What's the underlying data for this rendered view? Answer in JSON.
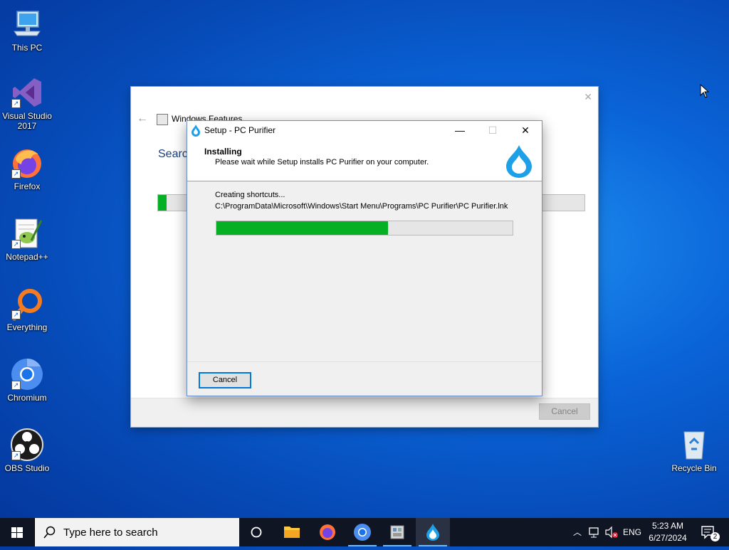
{
  "desktop": {
    "icons": [
      {
        "label": "This PC"
      },
      {
        "label": "Visual Studio 2017"
      },
      {
        "label": "Firefox"
      },
      {
        "label": "Notepad++"
      },
      {
        "label": "Everything"
      },
      {
        "label": "Chromium"
      },
      {
        "label": "OBS Studio"
      },
      {
        "label": "Recycle Bin"
      }
    ]
  },
  "windows_features": {
    "title": "Windows Features",
    "heading": "Search",
    "progress_fraction": 0.02,
    "cancel_label": "Cancel"
  },
  "setup": {
    "title": "Setup - PC Purifier",
    "header_title": "Installing",
    "header_subtitle": "Please wait while Setup installs PC Purifier on your computer.",
    "status": "Creating shortcuts...",
    "path": "C:\\ProgramData\\Microsoft\\Windows\\Start Menu\\Programs\\PC Purifier\\PC Purifier.lnk",
    "progress_fraction": 0.58,
    "cancel_label": "Cancel",
    "minimize_glyph": "—",
    "maximize_glyph": "☐",
    "close_glyph": "✕"
  },
  "taskbar": {
    "search_placeholder": "Type here to search",
    "language": "ENG",
    "time": "5:23 AM",
    "date": "6/27/2024",
    "notification_count": "2"
  },
  "colors": {
    "progress_green": "#06b025",
    "accent": "#0078d7"
  }
}
